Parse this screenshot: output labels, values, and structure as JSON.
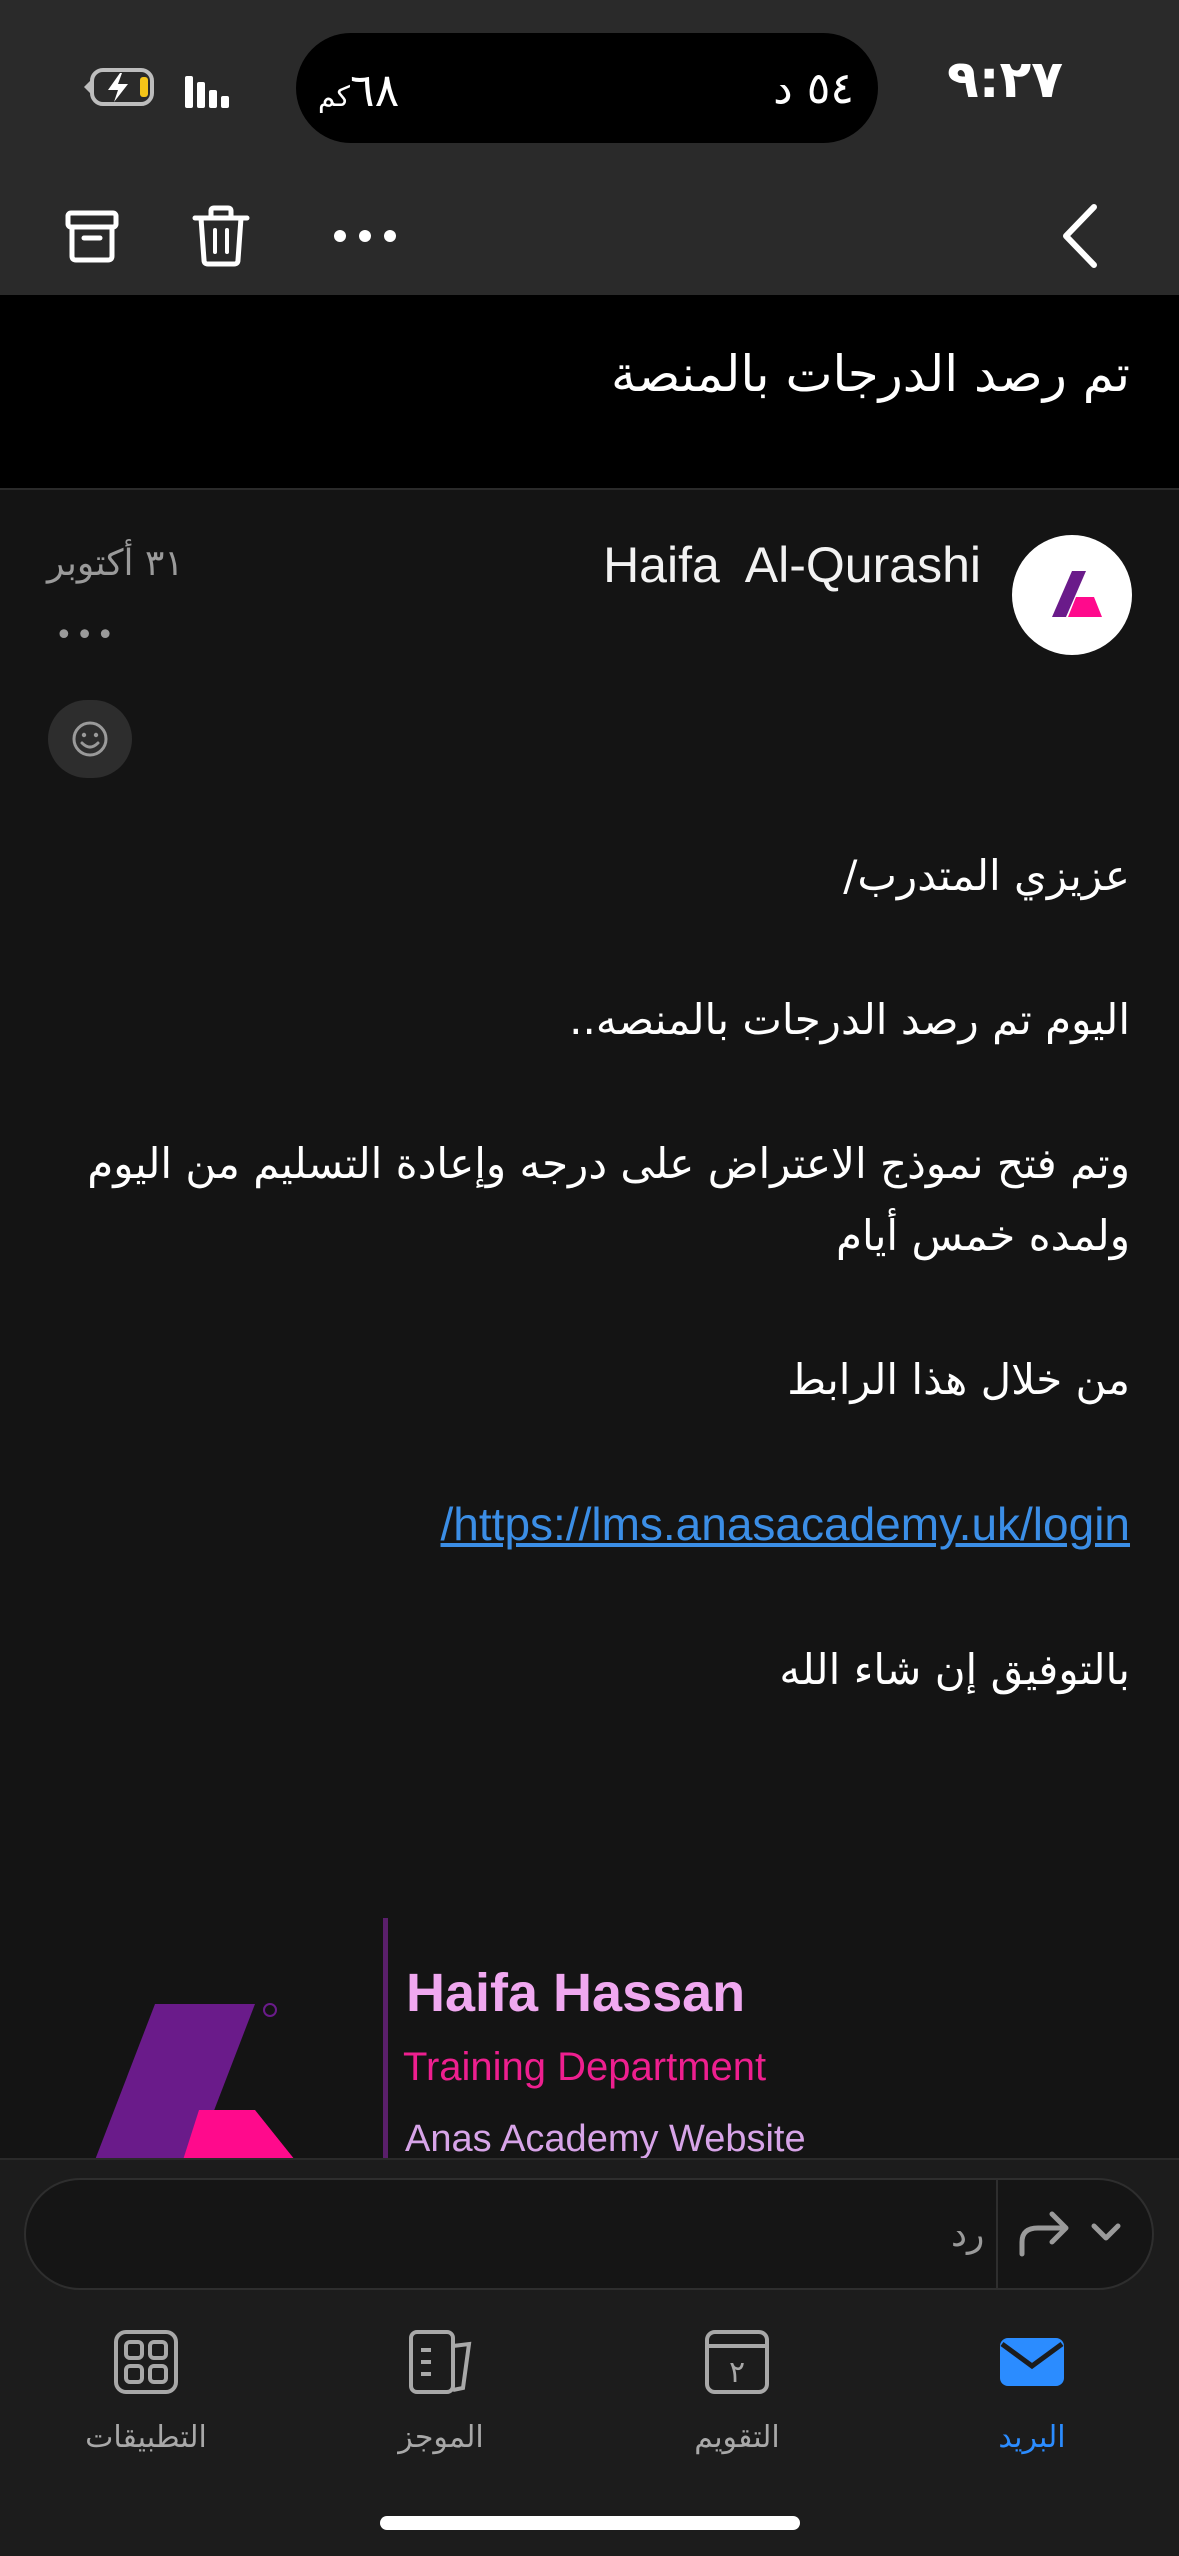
{
  "status_bar": {
    "time": "٩:٢٧",
    "distance_value": "٦٨",
    "distance_unit": "كم",
    "duration": "٥٤ د"
  },
  "toolbar": {
    "icons": [
      "archive-icon",
      "trash-icon",
      "more-icon",
      "back-chevron-icon"
    ]
  },
  "email": {
    "subject": "تم رصد الدرجات بالمنصة",
    "sender": "Haifa  Al-Qurashi",
    "date": "٣١ أكتوبر",
    "more": "•••",
    "body": {
      "greeting": "عزيزي المتدرب/",
      "line1": "اليوم تم رصد الدرجات بالمنصه..",
      "line2": "وتم فتح نموذج الاعتراض على درجه وإعادة التسليم من اليوم ولمده خمس أيام",
      "line3": "من خلال هذا الرابط",
      "link": "/https://lms.anasacademy.uk/login",
      "closing": "بالتوفيق إن شاء الله"
    },
    "signature": {
      "name": "Haifa Hassan",
      "department": "Training Department",
      "website": "Anas Academy Website"
    }
  },
  "reply": {
    "placeholder": "رد"
  },
  "tabs": [
    {
      "label": "البريد",
      "icon": "mail-icon",
      "active": true
    },
    {
      "label": "التقويم",
      "icon": "calendar-icon",
      "badge": "٢",
      "active": false
    },
    {
      "label": "الموجز",
      "icon": "feed-icon",
      "active": false
    },
    {
      "label": "التطبيقات",
      "icon": "apps-icon",
      "active": false
    }
  ],
  "colors": {
    "accent": "#2b8cff",
    "link": "#3b8ee6",
    "signature_name": "#f0a8f0",
    "signature_department": "#ee1f8f",
    "brand_purple": "#6a1b8a",
    "brand_pink": "#ff0a8c"
  }
}
